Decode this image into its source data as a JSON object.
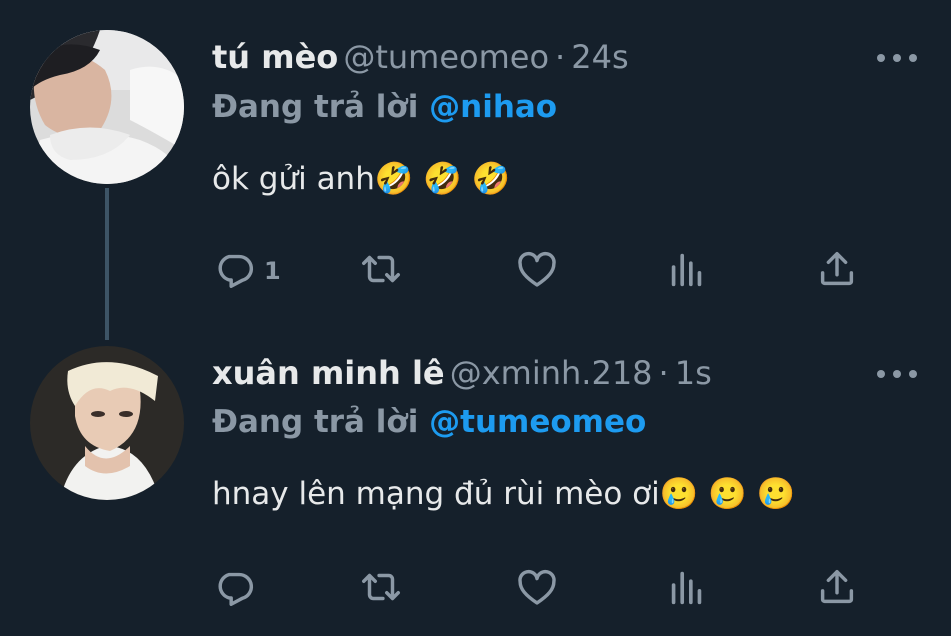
{
  "tweets": [
    {
      "name": "tú mèo",
      "handle": "@tumeomeo",
      "separator": "·",
      "time": "24s",
      "replying_prefix": "Đang trả lời",
      "replying_to": "@nihao",
      "text": "ôk gửi anh🤣 🤣 🤣",
      "reply_count": "1",
      "retweet_count": "",
      "like_count": ""
    },
    {
      "name": "xuân minh lê",
      "handle": "@xminh.218",
      "separator": "·",
      "time": "1s",
      "replying_prefix": "Đang trả lời",
      "replying_to": "@tumeomeo",
      "text": "hnay lên mạng đủ rùi mèo ơi🥲 🥲 🥲",
      "reply_count": "",
      "retweet_count": "",
      "like_count": ""
    }
  ],
  "icons": {
    "reply": "reply-icon",
    "retweet": "retweet-icon",
    "like": "heart-icon",
    "views": "views-icon",
    "share": "share-icon",
    "more": "more-icon"
  },
  "colors": {
    "background": "#15202b",
    "text": "#e7e9ea",
    "muted": "#8b98a5",
    "accent": "#1d9bf0"
  }
}
